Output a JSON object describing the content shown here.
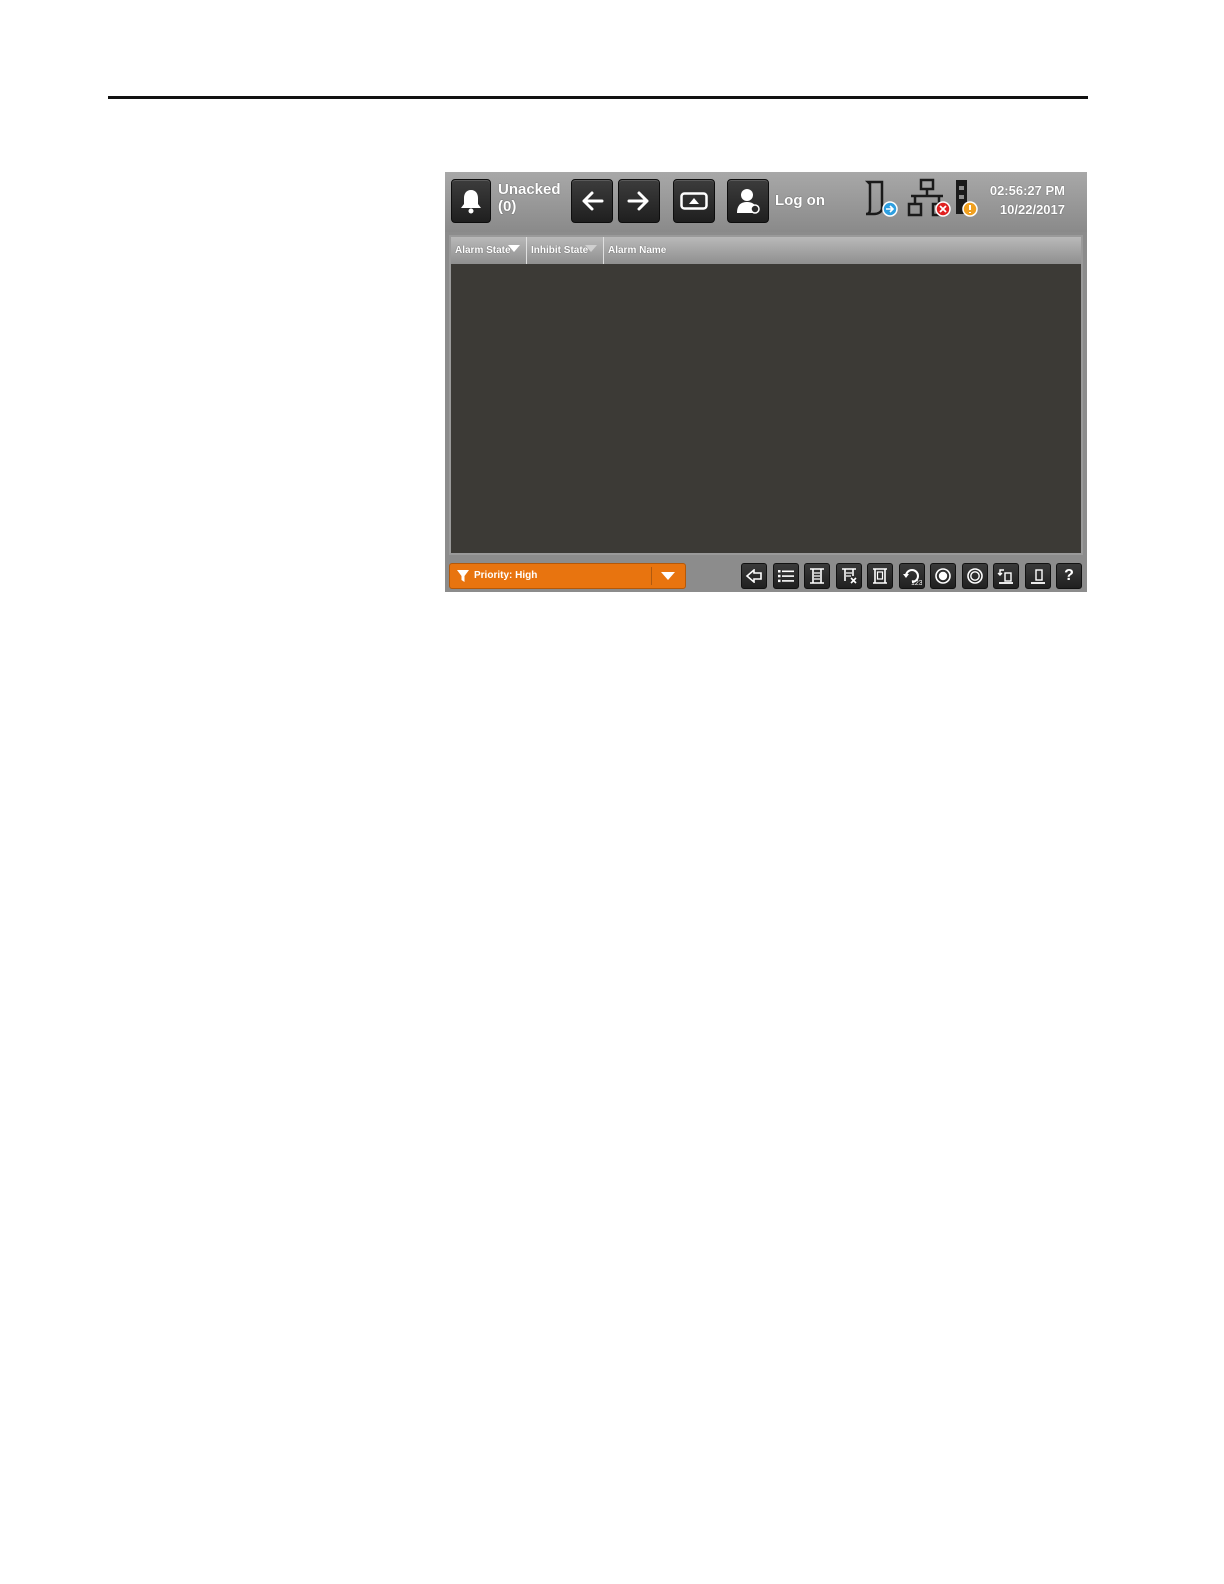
{
  "header": {
    "alarm_status_line1": "Unacked",
    "alarm_status_line2": "(0)",
    "logon_label": "Log on",
    "time": "02:56:27 PM",
    "date": "10/22/2017"
  },
  "table": {
    "columns": [
      "Alarm State",
      "Inhibit State",
      "Alarm Name"
    ],
    "rows": []
  },
  "filter": {
    "label": "Priority: High",
    "color": "#e8740f"
  },
  "toolbar": {
    "help_label": "?",
    "icons": [
      "back-icon",
      "list-icon",
      "select-all-icon",
      "deselect-icon",
      "details-icon",
      "refresh-count-icon",
      "radio-filled-icon",
      "radio-empty-icon",
      "shelve-icon",
      "unshelve-icon",
      "help-icon"
    ]
  }
}
